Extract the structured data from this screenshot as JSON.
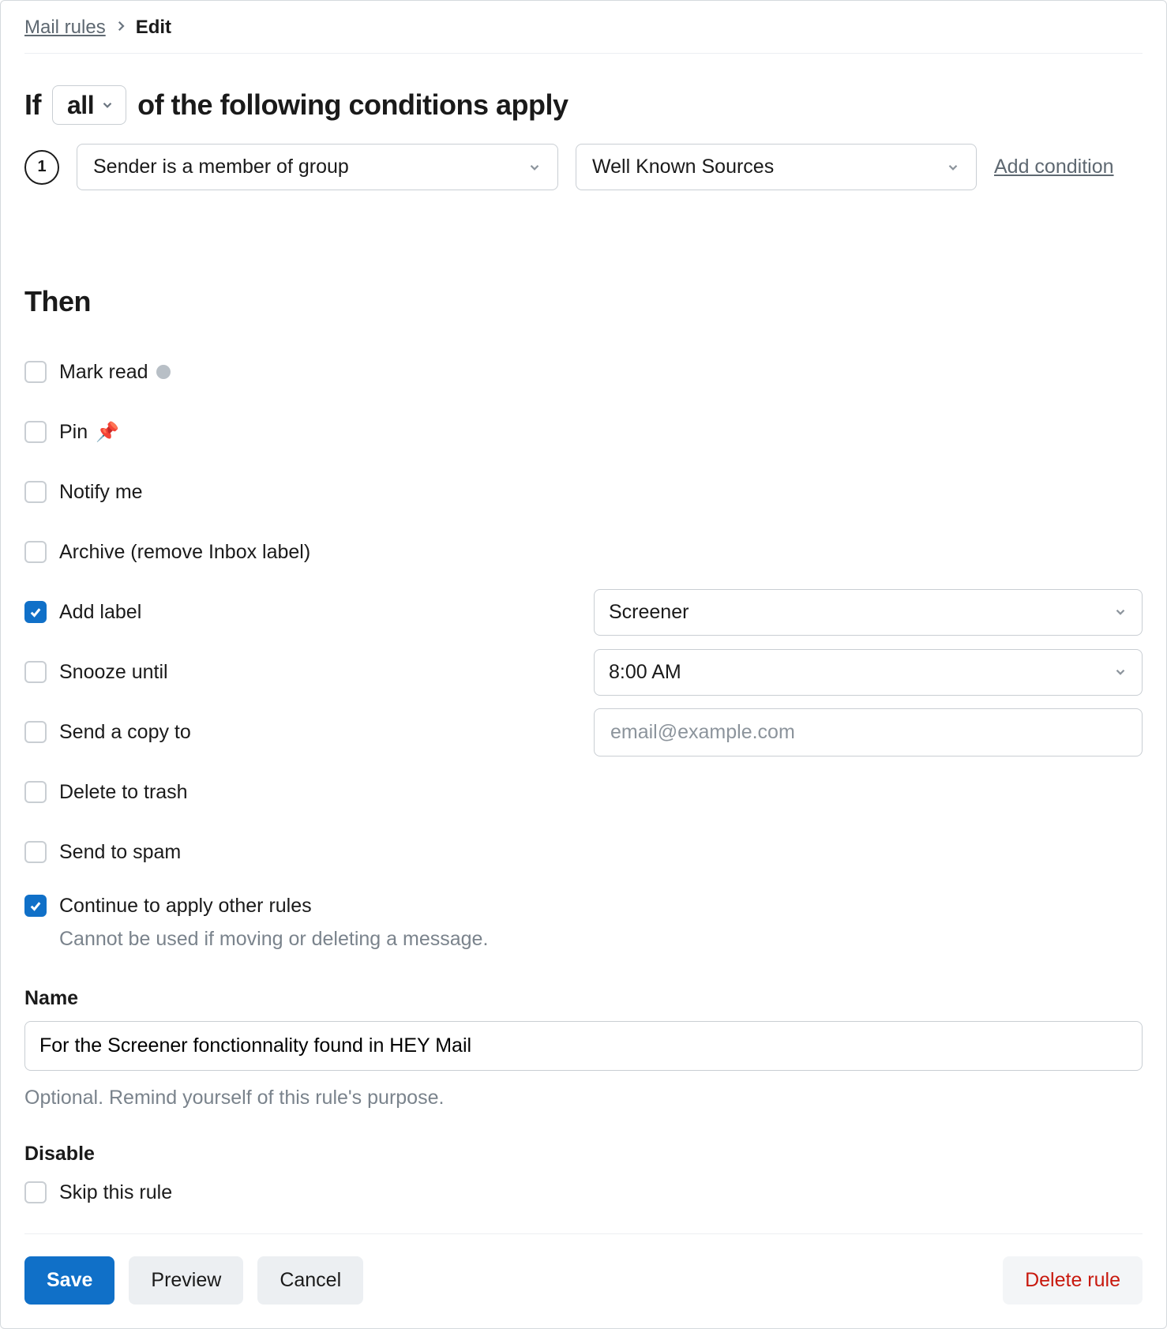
{
  "breadcrumb": {
    "root": "Mail rules",
    "current": "Edit"
  },
  "if": {
    "prefix": "If",
    "match_mode": "all",
    "suffix": "of the following conditions apply"
  },
  "condition": {
    "index": "1",
    "type": "Sender is a member of group",
    "value": "Well Known Sources",
    "add_label": "Add condition"
  },
  "then": {
    "heading": "Then",
    "mark_read": "Mark read",
    "pin": "Pin",
    "notify": "Notify me",
    "archive": "Archive (remove Inbox label)",
    "add_label": "Add label",
    "add_label_value": "Screener",
    "snooze": "Snooze until",
    "snooze_value": "8:00 AM",
    "send_copy": "Send a copy to",
    "send_copy_placeholder": "email@example.com",
    "delete": "Delete to trash",
    "spam": "Send to spam",
    "continue": "Continue to apply other rules",
    "continue_note": "Cannot be used if moving or deleting a message."
  },
  "checked": {
    "add_label": true,
    "continue": true
  },
  "name": {
    "label": "Name",
    "value": "For the Screener fonctionnality found in HEY Mail",
    "hint": "Optional. Remind yourself of this rule's purpose."
  },
  "disable": {
    "label": "Disable",
    "skip": "Skip this rule"
  },
  "footer": {
    "save": "Save",
    "preview": "Preview",
    "cancel": "Cancel",
    "delete": "Delete rule"
  }
}
